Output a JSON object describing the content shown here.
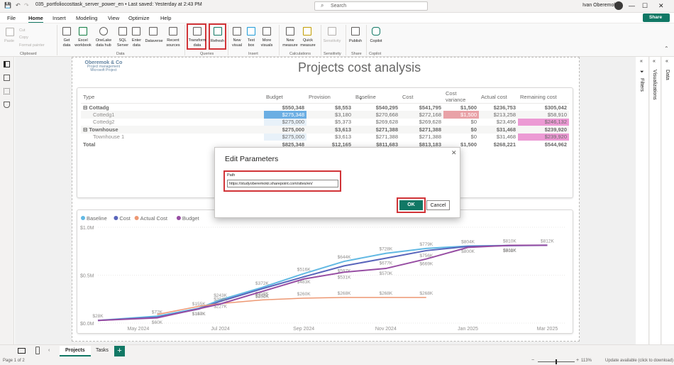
{
  "titlebar": {
    "doc_title": "035_portfoliocosttask_server_power_en • Last saved: Yesterday at 2:43 PM",
    "search_placeholder": "Search",
    "user": "Ivan Oberemok",
    "minimize": "—",
    "maximize": "☐",
    "close": "✕"
  },
  "menu": [
    "File",
    "Home",
    "Insert",
    "Modeling",
    "View",
    "Optimize",
    "Help"
  ],
  "share": "Share",
  "ribbon": {
    "clipboard": {
      "paste": "Paste",
      "cut": "Cut",
      "copy": "Copy",
      "format_painter": "Format painter",
      "group": "Clipboard"
    },
    "data": {
      "items": [
        "Get data",
        "Excel workbook",
        "OneLake data hub",
        "SQL Server",
        "Enter data",
        "Dataverse",
        "Recent sources"
      ],
      "group": "Data"
    },
    "queries": {
      "items": [
        "Transform data",
        "Refresh"
      ],
      "group": "Queries"
    },
    "insert": {
      "items": [
        "New visual",
        "Text box",
        "More visuals"
      ],
      "group": "Insert"
    },
    "calculations": {
      "items": [
        "New measure",
        "Quick measure"
      ],
      "group": "Calculations"
    },
    "sensitivity": {
      "items": [
        "Sensitivity"
      ],
      "group": "Sensitivity"
    },
    "share": {
      "items": [
        "Publish"
      ],
      "group": "Share"
    },
    "copilot": {
      "items": [
        "Copilot"
      ],
      "group": "Copilot"
    }
  },
  "right_panes": {
    "filters": "Filters",
    "visualizations": "Visualizations",
    "data": "Data"
  },
  "report": {
    "title": "Projects cost analysis",
    "logo": {
      "line1": "Oberemok & Co",
      "line2": "Project management",
      "line3": "Microsoft Project"
    }
  },
  "matrix": {
    "headers": [
      "Type",
      "Budget",
      "Provision",
      "Baseline",
      "Cost",
      "Cost variance",
      "Actual cost",
      "Remaining cost"
    ],
    "rows": [
      {
        "kind": "parent",
        "expander": "⊟",
        "cells": [
          "Cottadg",
          "$550,348",
          "$8,553",
          "$540,295",
          "$541,795",
          "$1,500",
          "$236,753",
          "$305,042"
        ]
      },
      {
        "kind": "child",
        "cells": [
          "Cottedg1",
          "$275,348",
          "$3,180",
          "$270,668",
          "$272,168",
          "$1,500",
          "$213,258",
          "$58,910"
        ]
      },
      {
        "kind": "child",
        "cells": [
          "Cottedg2",
          "$275,000",
          "$5,373",
          "$269,628",
          "$269,628",
          "$0",
          "$23,496",
          "$246,132"
        ]
      },
      {
        "kind": "parent",
        "expander": "⊟",
        "cells": [
          "Townhouse",
          "$275,000",
          "$3,613",
          "$271,388",
          "$271,388",
          "$0",
          "$31,468",
          "$239,920"
        ]
      },
      {
        "kind": "child",
        "cells": [
          "Townhouse 1",
          "$275,000",
          "$3,613",
          "$271,388",
          "$271,388",
          "$0",
          "$31,468",
          "$239,920"
        ]
      },
      {
        "kind": "total",
        "cells": [
          "Total",
          "$825,348",
          "$12,165",
          "$811,683",
          "$813,183",
          "$1,500",
          "$268,221",
          "$544,962"
        ]
      }
    ]
  },
  "dialog": {
    "title": "Edit Parameters",
    "field_label": "Path",
    "field_value": "https://studyoberemokii.sharepoint.com/sites/en/",
    "ok": "OK",
    "cancel": "Cancel",
    "close": "✕"
  },
  "colors": {
    "accent": "#117865",
    "highlight": "#d13438",
    "baseline": "#1f9bd7",
    "cost": "#12239e",
    "actual": "#e66c37",
    "budget": "#6b007b"
  },
  "chart_data": {
    "type": "line",
    "legend": [
      "Baseline",
      "Cost",
      "Actual Cost",
      "Budget"
    ],
    "y_ticks": [
      "$0.0M",
      "$0.5M",
      "$1.0M"
    ],
    "ylim": [
      0,
      1000000
    ],
    "x_ticks": [
      "May 2024",
      "Jul 2024",
      "Sep 2024",
      "Nov 2024",
      "Jan 2025",
      "Mar 2025"
    ],
    "series": [
      {
        "name": "Baseline",
        "dates": [
          "2024-04-01",
          "2024-05-15",
          "2024-06-15",
          "2024-07-01",
          "2024-08-01",
          "2024-09-01",
          "2024-10-01",
          "2024-11-01",
          "2024-12-01",
          "2025-01-01",
          "2025-02-01",
          "2025-03-01"
        ],
        "values": [
          28000,
          72000,
          155000,
          243000,
          372000,
          516000,
          644000,
          728000,
          779000,
          804000,
          810000,
          812000
        ],
        "labels": [
          "$28K",
          "$72K",
          "$155K",
          "$243K",
          "$372K",
          "$516K",
          "$644K",
          "$728K",
          "$779K",
          "$804K",
          "$810K",
          "$812K"
        ]
      },
      {
        "name": "Cost",
        "dates": [
          "2024-04-01",
          "2024-05-15",
          "2024-06-15",
          "2024-07-01",
          "2024-08-01",
          "2024-09-01",
          "2024-10-01",
          "2024-11-01",
          "2024-12-01",
          "2025-01-01",
          "2025-02-01",
          "2025-03-01"
        ],
        "values": [
          28000,
          60000,
          147000,
          227000,
          358000,
          483000,
          597000,
          677000,
          756000,
          800000,
          808000,
          812000
        ],
        "labels": [
          "",
          "$60K",
          "$147K",
          "$227K",
          "$358K",
          "$483K",
          "$597K",
          "$677K",
          "$756K",
          "$800K",
          "$808K",
          ""
        ]
      },
      {
        "name": "Actual Cost",
        "dates": [
          "2024-05-15",
          "2024-06-15",
          "2024-07-01",
          "2024-08-01",
          "2024-09-01",
          "2024-10-01",
          "2024-11-01",
          "2024-12-01"
        ],
        "values": [
          90000,
          175000,
          204000,
          242000,
          260000,
          268000,
          268000,
          268000
        ],
        "labels": [
          "",
          "",
          "$204K",
          "$242K",
          "$260K",
          "$268K",
          "$268K",
          "$268K"
        ]
      },
      {
        "name": "Budget",
        "dates": [
          "2024-04-01",
          "2024-05-15",
          "2024-06-15",
          "2024-07-01",
          "2024-08-01",
          "2024-09-01",
          "2024-10-01",
          "2024-11-01",
          "2024-12-01",
          "2025-01-01",
          "2025-02-01",
          "2025-03-01"
        ],
        "values": [
          28000,
          55000,
          150000,
          200000,
          330000,
          460000,
          531000,
          570000,
          669000,
          790000,
          811000,
          812000
        ],
        "labels": [
          "",
          "",
          "$150K",
          "",
          "$330K",
          "",
          "$531K",
          "$570K",
          "$669K",
          "",
          "$811K",
          ""
        ]
      }
    ]
  },
  "page_tabs": [
    "Projects",
    "Tasks"
  ],
  "add_tab": "+",
  "status": {
    "page": "Page 1 of 2",
    "zoom": "113%",
    "update": "Update available (click to download)"
  }
}
